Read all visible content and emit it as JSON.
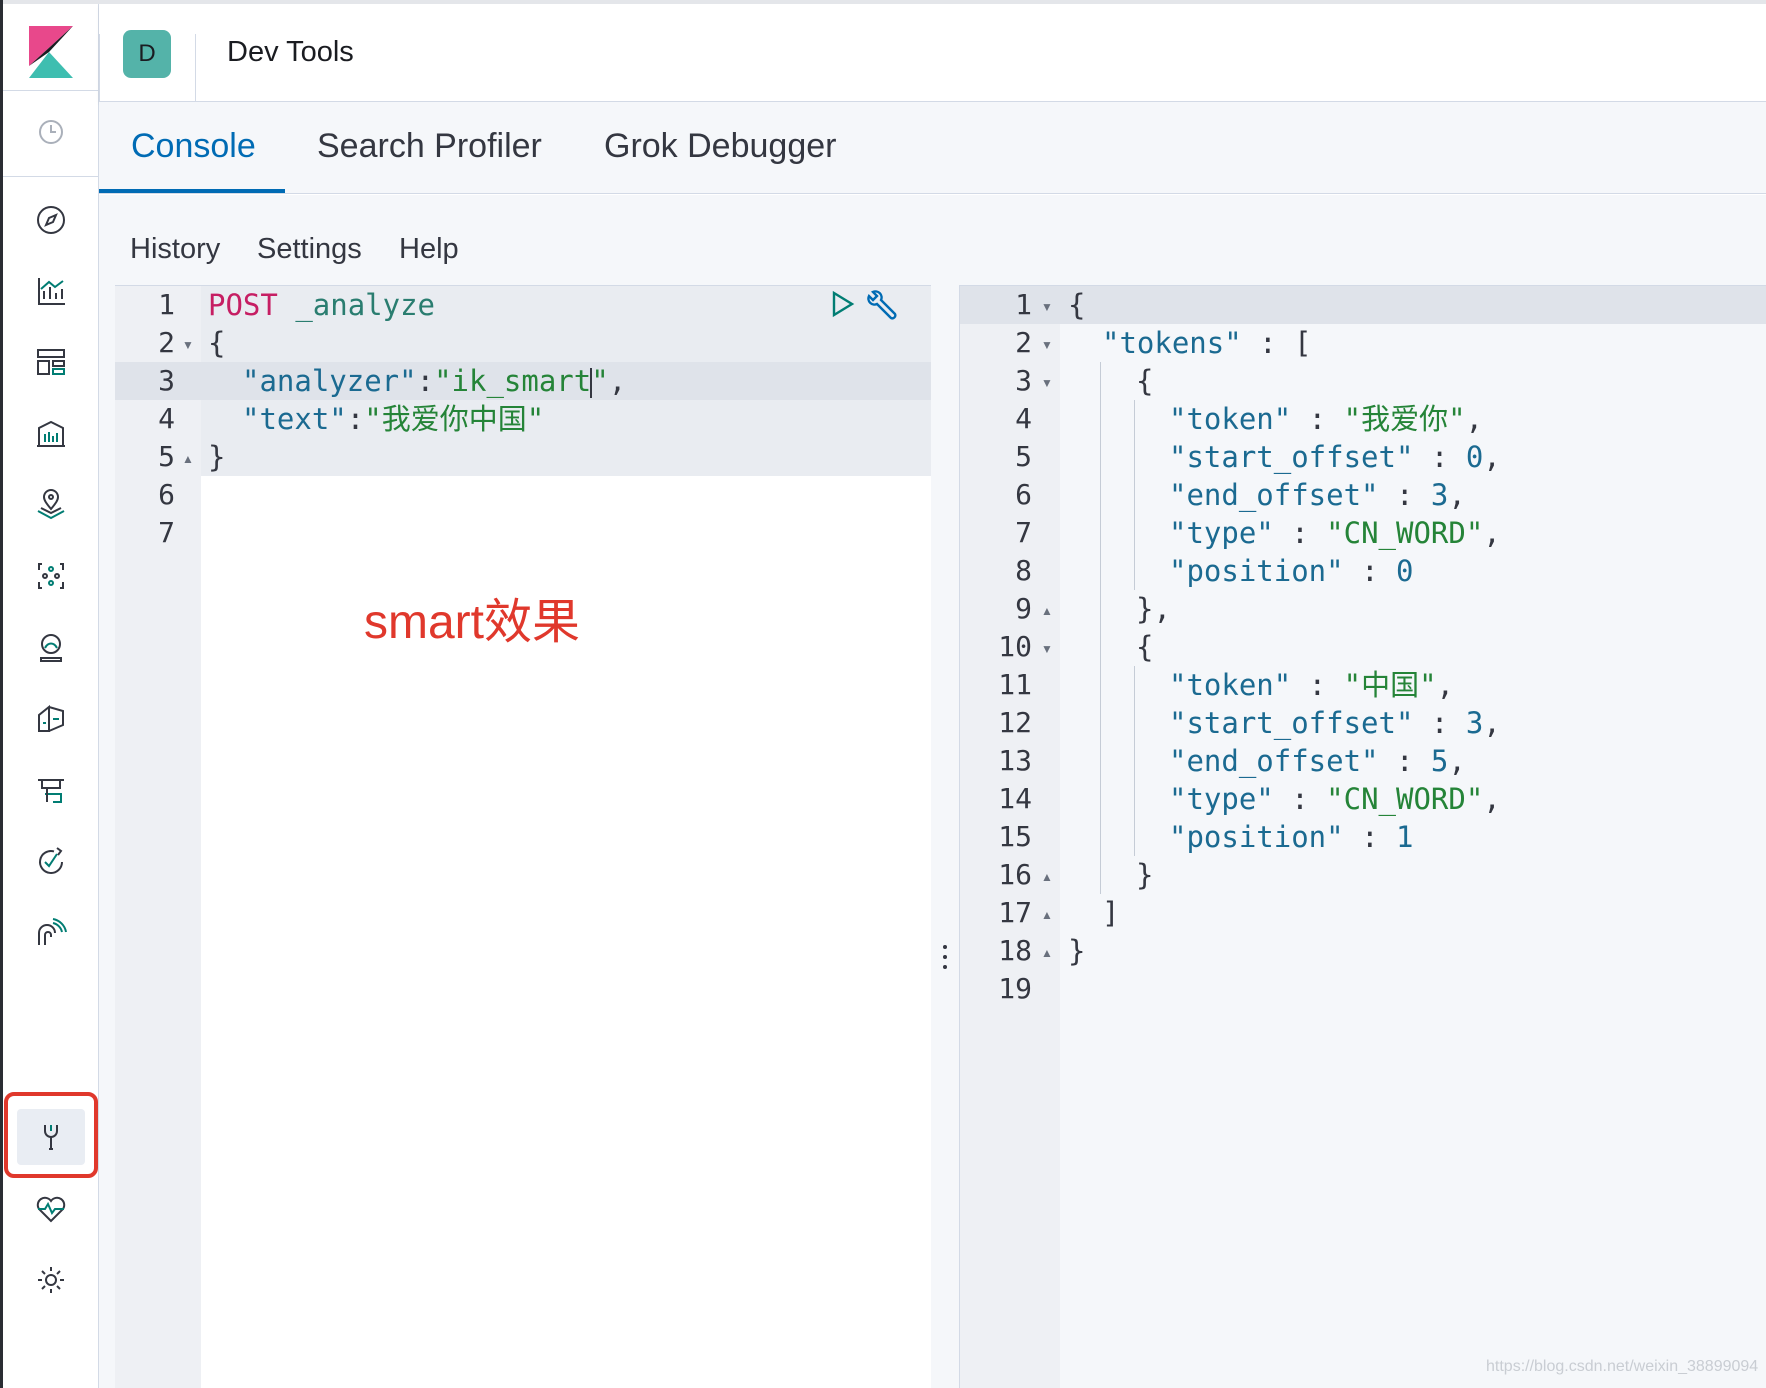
{
  "app": {
    "space_initial": "D",
    "title": "Dev Tools"
  },
  "tabs": [
    {
      "label": "Console",
      "active": true
    },
    {
      "label": "Search Profiler",
      "active": false
    },
    {
      "label": "Grok Debugger",
      "active": false
    }
  ],
  "console_menu": {
    "history": "History",
    "settings": "Settings",
    "help": "Help"
  },
  "sidebar_icons": [
    "recently-viewed-clock-icon",
    "discover-compass-icon",
    "visualize-chart-icon",
    "dashboard-icon",
    "canvas-icon",
    "maps-icon",
    "machine-learning-icon",
    "infrastructure-icon",
    "logs-icon",
    "apm-icon",
    "uptime-icon",
    "siem-icon",
    "dev-tools-icon",
    "stack-monitoring-icon",
    "management-gear-icon"
  ],
  "request": {
    "line_numbers": [
      "1",
      "2",
      "3",
      "4",
      "5",
      "6",
      "7"
    ],
    "method": "POST",
    "endpoint": "_analyze",
    "open_brace": "{",
    "close_brace": "}",
    "key_analyzer": "\"analyzer\"",
    "val_analyzer_a": "\"ik_smart",
    "val_analyzer_b": "\"",
    "key_text": "\"text\"",
    "val_text": "\"我爱你中国\"",
    "colon": ":",
    "comma": ","
  },
  "response": {
    "line_numbers": [
      "1",
      "2",
      "3",
      "4",
      "5",
      "6",
      "7",
      "8",
      "9",
      "10",
      "11",
      "12",
      "13",
      "14",
      "15",
      "16",
      "17",
      "18",
      "19"
    ],
    "open_brace": "{",
    "close_brace": "}",
    "tokens_key": "\"tokens\"",
    "open_bracket": "[",
    "close_bracket": "]",
    "sep": " : ",
    "comma": ",",
    "obj_close_comma": "},",
    "k_token": "\"token\"",
    "k_start_offset": "\"start_offset\"",
    "k_end_offset": "\"end_offset\"",
    "k_type": "\"type\"",
    "k_position": "\"position\"",
    "tokens": [
      {
        "token": "\"我爱你\"",
        "start_offset": "0",
        "end_offset": "3",
        "type": "\"CN_WORD\"",
        "position": "0"
      },
      {
        "token": "\"中国\"",
        "start_offset": "3",
        "end_offset": "5",
        "type": "\"CN_WORD\"",
        "position": "1"
      }
    ]
  },
  "annotation": "smart效果",
  "watermark": "https://blog.csdn.net/weixin_38899094",
  "colors": {
    "accent": "#006bb4",
    "annotation_red": "#e0382c",
    "space_avatar": "#54b3a9"
  }
}
